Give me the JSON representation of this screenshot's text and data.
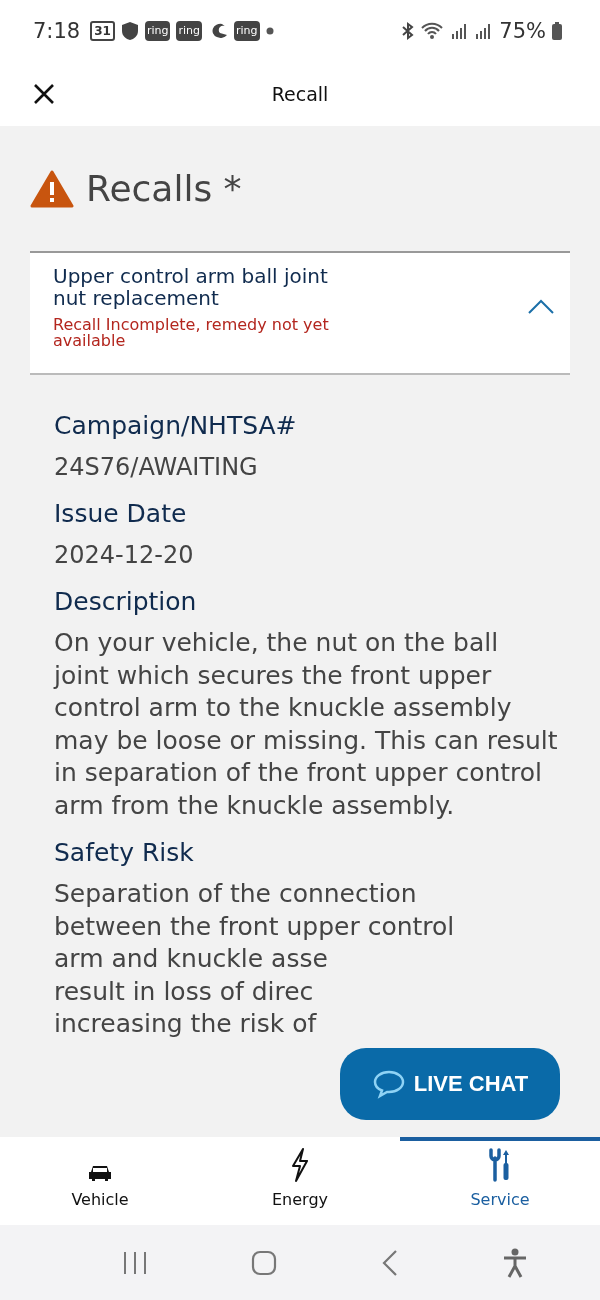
{
  "status_bar": {
    "time": "7:18",
    "notifications": [
      {
        "kind": "calendar",
        "label": "31"
      },
      {
        "kind": "shield"
      },
      {
        "kind": "app",
        "label": "ring"
      },
      {
        "kind": "app",
        "label": "ring"
      },
      {
        "kind": "crescent"
      },
      {
        "kind": "app",
        "label": "ring"
      },
      {
        "kind": "dot"
      }
    ],
    "battery": "75%"
  },
  "header": {
    "title": "Recall"
  },
  "page": {
    "title": "Recalls *"
  },
  "recall": {
    "title": "Upper control arm ball joint nut replacement",
    "status": "Recall Incomplete, remedy not yet available",
    "expanded": true
  },
  "details": [
    {
      "label": "Campaign/NHTSA#",
      "value": "24S76/AWAITING"
    },
    {
      "label": "Issue Date",
      "value": "2024-12-20"
    },
    {
      "label": "Description",
      "text": "On your vehicle, the nut on the ball joint which secures the front upper control arm to the knuckle assembly may be loose or missing. This can result in separation of the front upper control arm from the knuckle assembly."
    },
    {
      "label": "Safety Risk",
      "lines": [
        "Separation of the connection",
        "between the front upper control",
        "arm and knuckle asse",
        "result in loss of direc",
        "increasing the risk of"
      ]
    }
  ],
  "live_chat": {
    "label": "LIVE CHAT"
  },
  "tabs": [
    {
      "kind": "vehicle",
      "label": "Vehicle",
      "selected": false
    },
    {
      "kind": "energy",
      "label": "Energy",
      "selected": false
    },
    {
      "kind": "service",
      "label": "Service",
      "selected": true
    }
  ]
}
